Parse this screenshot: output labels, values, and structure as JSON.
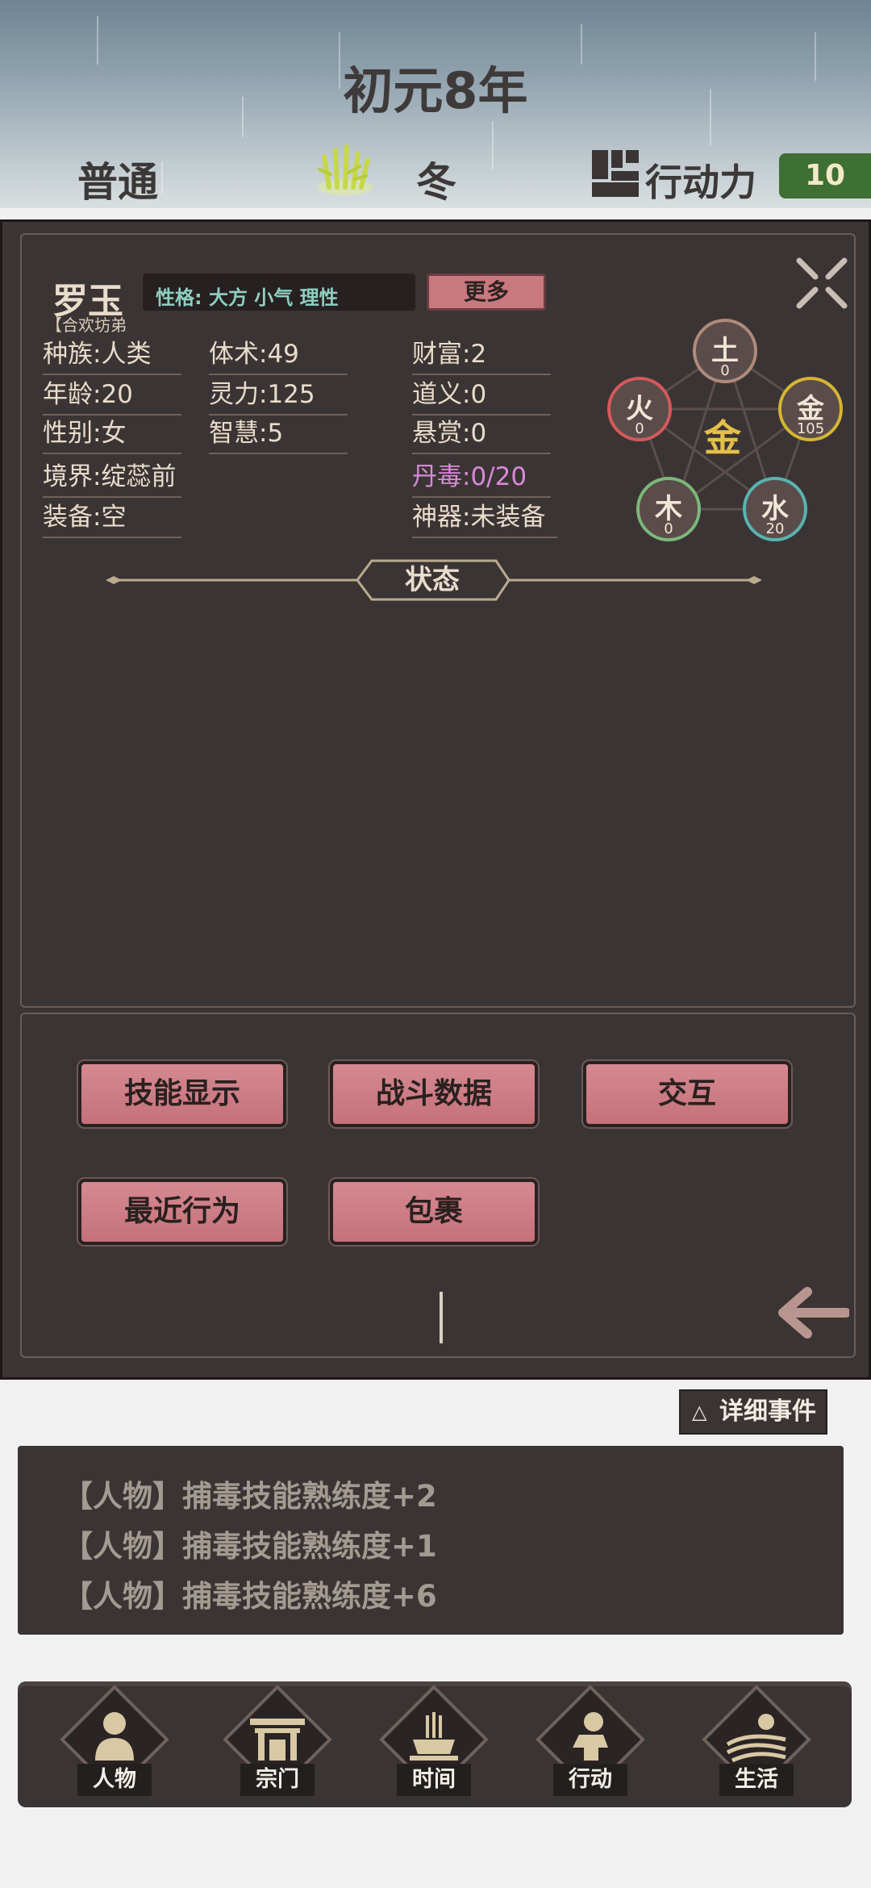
{
  "header": {
    "year_title": "初元8年",
    "mode": "普通",
    "season": "冬",
    "action_points_label": "行动力",
    "action_points_value": "10"
  },
  "character": {
    "name": "罗玉",
    "sect": "【合欢坊弟",
    "personality": "性格: 大方  小气  理性",
    "more_label": "更多",
    "stats": {
      "race": "种族:人类",
      "age": "年龄:20",
      "gender": "性别:女",
      "realm": "境界:绽蕊前",
      "equipment": "装备:空",
      "body_art": "体术:49",
      "spirit": "灵力:125",
      "wisdom": "智慧:5",
      "wealth": "财富:2",
      "righteousness": "道义:0",
      "bounty": "悬赏:0",
      "pill_poison": "丹毒:0/20",
      "artifact": "神器:未装备"
    }
  },
  "wuxing": {
    "center": "金",
    "earth": {
      "name": "土",
      "value": "0",
      "color": "#b08a7a"
    },
    "metal": {
      "name": "金",
      "value": "105",
      "color": "#d6b532"
    },
    "water": {
      "name": "水",
      "value": "20",
      "color": "#58b4b0"
    },
    "wood": {
      "name": "木",
      "value": "0",
      "color": "#7cb87a"
    },
    "fire": {
      "name": "火",
      "value": "0",
      "color": "#d45a5a"
    }
  },
  "status_label": "状态",
  "actions": {
    "skills": "技能显示",
    "battle": "战斗数据",
    "interact": "交互",
    "recent": "最近行为",
    "bag": "包裹"
  },
  "events": {
    "toggle_label": "详细事件",
    "toggle_icon": "△",
    "lines": [
      "【人物】捕毒技能熟练度+2",
      "【人物】捕毒技能熟练度+1",
      "【人物】捕毒技能熟练度+6"
    ]
  },
  "nav": [
    {
      "label": "人物",
      "icon": "person-icon"
    },
    {
      "label": "宗门",
      "icon": "sect-gate-icon"
    },
    {
      "label": "时间",
      "icon": "incense-icon"
    },
    {
      "label": "行动",
      "icon": "action-icon"
    },
    {
      "label": "生活",
      "icon": "life-icon"
    }
  ]
}
